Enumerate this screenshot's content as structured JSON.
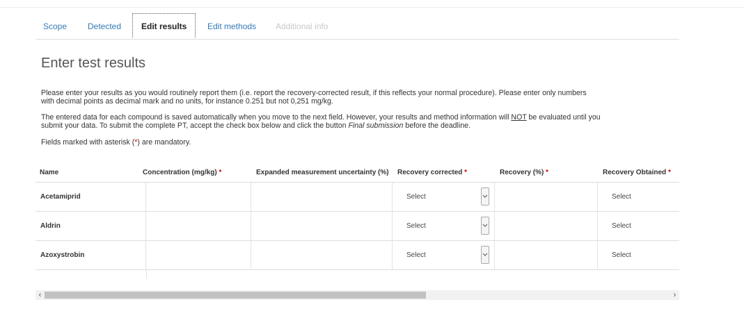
{
  "tabs": [
    {
      "label": "Scope",
      "state": "normal"
    },
    {
      "label": "Detected",
      "state": "normal"
    },
    {
      "label": "Edit results",
      "state": "active"
    },
    {
      "label": "Edit methods",
      "state": "normal"
    },
    {
      "label": "Additional info",
      "state": "disabled"
    }
  ],
  "page_title": "Enter test results",
  "instructions": {
    "p1_line1": "Please enter your results as you would routinely report them (i.e. report the recovery-corrected result, if this reflects your normal procedure). Please enter only numbers",
    "p1_line2": "with decimal points as decimal mark and no units, for instance 0.251 but not 0,251 mg/kg.",
    "p2_a": "The entered data for each compound is saved automatically when you move to the next field. However, your results and method information will ",
    "p2_not": "NOT",
    "p2_b": " be evaluated until you",
    "p2_c": "submit your data. To submit the complete PT, accept the check box below and click the button ",
    "p2_final": "Final submission",
    "p2_d": " before the deadline.",
    "p3_a": "Fields marked with asterisk (",
    "p3_star": "*",
    "p3_b": ") are mandatory."
  },
  "table": {
    "columns": {
      "name": "Name",
      "concentration": "Concentration (mg/kg)",
      "uncertainty": "Expanded measurement uncertainty (%)",
      "recovery_corrected": "Recovery corrected",
      "recovery": "Recovery (%)",
      "recovery_obtained": "Recovery Obtained"
    },
    "required_marker": "*",
    "rows": [
      {
        "name": "Acetamiprid",
        "recovery_corrected": "Select",
        "recovery_obtained": "Select"
      },
      {
        "name": "Aldrin",
        "recovery_corrected": "Select",
        "recovery_obtained": "Select"
      },
      {
        "name": "Azoxystrobin",
        "recovery_corrected": "Select",
        "recovery_obtained": "Select"
      }
    ]
  },
  "scrollbar": {
    "left_arrow": "‹",
    "right_arrow": "›"
  },
  "colors": {
    "link": "#337ab7",
    "required": "#cc0000",
    "disabled": "#c8c8c8"
  }
}
